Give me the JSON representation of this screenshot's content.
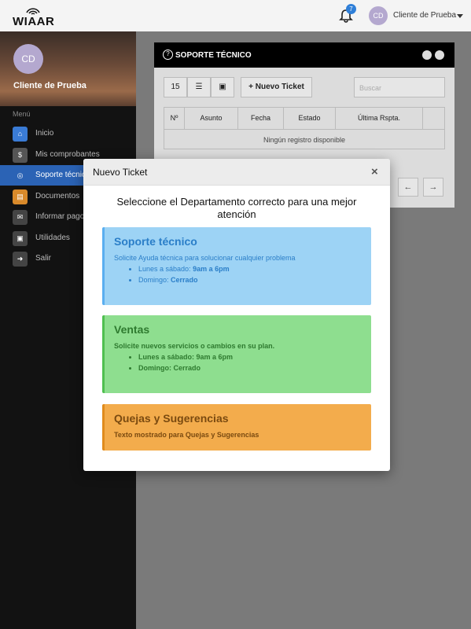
{
  "topbar": {
    "logo_text": "WIAAR",
    "notification_count": "7",
    "user_initials": "CD",
    "user_name": "Cliente de Prueba"
  },
  "sidebar": {
    "avatar_initials": "CD",
    "name": "Cliente de Prueba",
    "menu_label": "Menú",
    "items": [
      {
        "label": "Inicio",
        "icon": "home-icon",
        "color": "#3a7bd5"
      },
      {
        "label": "Mis comprobantes",
        "icon": "receipt-icon",
        "color": "#555555"
      },
      {
        "label": "Soporte técnico",
        "icon": "lifebuoy-icon",
        "color": "#2b63b5"
      },
      {
        "label": "Documentos",
        "icon": "document-icon",
        "color": "#d98a2b"
      },
      {
        "label": "Informar pago",
        "icon": "envelope-icon",
        "color": "#444444"
      },
      {
        "label": "Utilidades",
        "icon": "toolbox-icon",
        "color": "#444444"
      },
      {
        "label": "Salir",
        "icon": "logout-icon",
        "color": "#444444"
      }
    ]
  },
  "panel": {
    "title": "SOPORTE TÉCNICO",
    "page_size": "15",
    "new_ticket_label": "+ Nuevo Ticket",
    "search_placeholder": "Buscar",
    "columns": [
      "Nº",
      "Asunto",
      "Fecha",
      "Estado",
      "Última Rspta.",
      ""
    ],
    "no_data": "Ningún registro disponible"
  },
  "modal": {
    "title": "Nuevo Ticket",
    "close": "×",
    "heading": "Seleccione el Departamento correcto para una mejor atención",
    "cards": [
      {
        "title": "Soporte técnico",
        "description": "Solicite Ayuda técnica para solucionar cualquier problema",
        "hours": [
          {
            "label": "Lunes a sábado:",
            "value": "9am a 6pm"
          },
          {
            "label": "Domingo:",
            "value": "Cerrado"
          }
        ]
      },
      {
        "title": "Ventas",
        "description": "Solicite nuevos servicios o cambios en su plan.",
        "hours": [
          {
            "label": "Lunes a sábado:",
            "value": "9am a 6pm"
          },
          {
            "label": "Domingo:",
            "value": "Cerrado"
          }
        ]
      },
      {
        "title": "Quejas y Sugerencias",
        "description": "Texto mostrado para Quejas y Sugerencias"
      }
    ]
  }
}
